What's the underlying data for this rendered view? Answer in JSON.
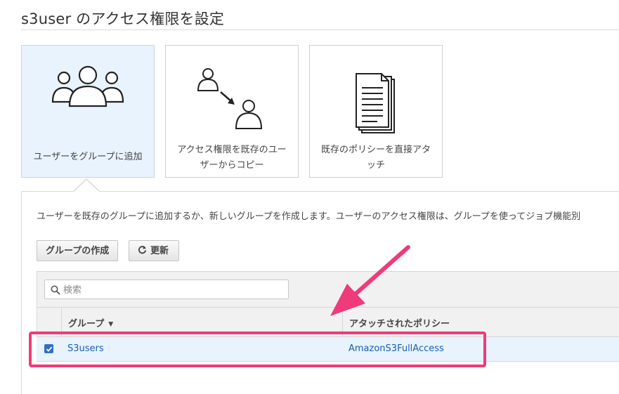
{
  "page": {
    "title": "s3user のアクセス権限を設定"
  },
  "options": [
    {
      "label": "ユーザーをグループに追加",
      "icon": "users-group-icon"
    },
    {
      "label_line1": "アクセス権限を既存のユー",
      "label_line2": "ザーからコピー",
      "icon": "copy-user-icon"
    },
    {
      "label_line1": "既存のポリシーを直接アタ",
      "label_line2": "ッチ",
      "icon": "document-stack-icon"
    }
  ],
  "panel": {
    "description": "ユーザーを既存のグループに追加するか、新しいグループを作成します。ユーザーのアクセス権限は、グループを使ってジョブ機能別"
  },
  "toolbar": {
    "create_group_label": "グループの作成",
    "refresh_label": "更新"
  },
  "search": {
    "placeholder": "検索",
    "value": ""
  },
  "table": {
    "columns": [
      "グループ",
      "アタッチされたポリシー"
    ],
    "rows": [
      {
        "checked": true,
        "group": "S3users",
        "policy": "AmazonS3FullAccess"
      }
    ]
  },
  "annotation": {
    "color": "#ef3b79"
  },
  "colors": {
    "selected_bg": "#e8f3fd",
    "link": "#1a5fb4",
    "checkbox": "#2e6dc9"
  }
}
